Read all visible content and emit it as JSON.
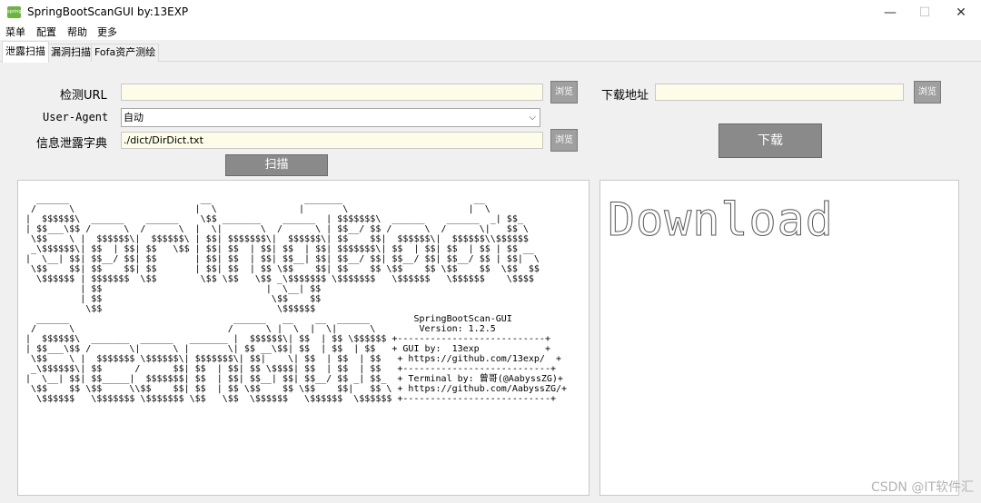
{
  "window": {
    "title": "SpringBootScanGUI   by:13EXP",
    "icon_text": "spring",
    "minimize": "—",
    "maximize": "☐",
    "close": "✕"
  },
  "menu": [
    "菜单",
    "配置",
    "帮助",
    "更多"
  ],
  "tabs": [
    {
      "label": "泄露扫描",
      "active": true
    },
    {
      "label": "漏洞扫描",
      "active": false
    },
    {
      "label": "Fofa资产测绘",
      "active": false
    }
  ],
  "form": {
    "url_label": "检测URL",
    "url_value": "",
    "ua_label": "User-Agent",
    "ua_value": "自动",
    "dict_label": "信息泄露字典",
    "dict_value": "./dict/DirDict.txt",
    "browse_label": "浏览",
    "scan_label": "扫描",
    "download_addr_label": "下载地址",
    "download_addr_value": "",
    "download_label": "下载"
  },
  "console": {
    "ascii_banner": "  ______                        __                 _______                        __    \n /      \\                      |  \\               |       \\                      |  \\   \n|  $$$$$$\\  ______    ______    \\$$ _______    ______  | $$$$$$$\\  ______    ______  _| $$_  \n| $$___\\$$ /      \\  /      \\  |  \\|       \\  /      \\ | $$__/ $$ /      \\  /      \\|   $$ \\ \n \\$$    \\ |  $$$$$$\\|  $$$$$$\\ | $$| $$$$$$$\\|  $$$$$$\\| $$    $$|  $$$$$$\\|  $$$$$$\\\\$$$$$$ \n _\\$$$$$$\\| $$  | $$| $$   \\$$ | $$| $$  | $$| $$  | $$| $$$$$$$\\| $$  | $$| $$  | $$ | $$ __\n|  \\__| $$| $$__/ $$| $$       | $$| $$  | $$| $$__| $$| $$__/ $$| $$__/ $$| $$__/ $$ | $$|  \\\n \\$$    $$| $$    $$| $$       | $$| $$  | $$ \\$$    $$| $$    $$ \\$$    $$ \\$$    $$  \\$$  $$\n  \\$$$$$$ | $$$$$$$  \\$$        \\$$ \\$$   \\$$ _\\$$$$$$$ \\$$$$$$$   \\$$$$$$   \\$$$$$$    \\$$$$ \n          | $$                              |  \\__| $$                                       \n          | $$                               \\$$    $$                                       \n           \\$$                                \\$$$$$$                                        \n  ______                              ______   __    __  ______        SpringBootScan-GUI\n /      \\                            /      \\ |  \\  |  \\|      \\        Version: 1.2.5\n|  $$$$$$\\  _______  ______   _______ |  $$$$$$\\| $$  | $$ \\$$$$$$ +---------------------------+\n| $$___\\$$ /       \\|      \\ |       \\| $$ __\\$$| $$  | $$  | $$   + GUI by:  13exp            +\n \\$$    \\ |  $$$$$$$ \\$$$$$$\\| $$$$$$$\\| $$|    \\| $$  | $$  | $$   + https://github.com/13exp/  +\n _\\$$$$$$\\| $$      /      $$| $$  | $$| $$ \\$$$$| $$  | $$  | $$   +---------------------------+\n|  \\__| $$| $$_____|  $$$$$$$| $$  | $$| $$__| $$| $$__/ $$ _| $$_  + Terminal by: 曾哥(@AabyssZG)+\n \\$$    $$ \\$$     \\\\$$    $$| $$  | $$ \\$$    $$ \\$$    $$|   $$ \\ + https://github.com/AabyssZG/+\n  \\$$$$$$   \\$$$$$$$ \\$$$$$$$ \\$$   \\$$  \\$$$$$$   \\$$$$$$  \\$$$$$$ +---------------------------+",
    "download_art": "Download"
  },
  "watermark": "CSDN @IT软件汇",
  "colors": {
    "input_bg": "#fcfce8",
    "browse_bg": "#9f9f9f",
    "button_bg": "#8a8a8a",
    "spring_green": "#6db33f"
  }
}
